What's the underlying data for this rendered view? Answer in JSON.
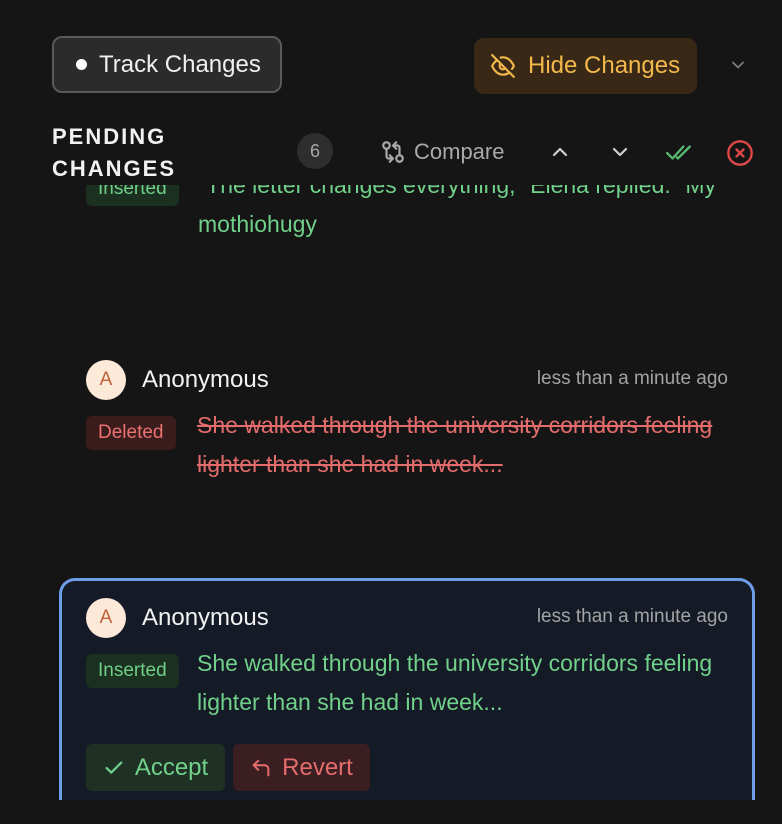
{
  "toolbar": {
    "track_label": "Track Changes",
    "hide_label": "Hide Changes"
  },
  "pending": {
    "title": "PENDING CHANGES",
    "count": "6",
    "compare_label": "Compare"
  },
  "changes": [
    {
      "type_label": "Inserted",
      "text": "\"The letter changes everything,\" Elena replied. \"My mothiohugy",
      "partial": true
    },
    {
      "avatar_letter": "A",
      "author": "Anonymous",
      "time": "less than a minute ago",
      "type_label": "Deleted",
      "text": "She walked through the university corridors feeling lighter than she had in week..."
    },
    {
      "avatar_letter": "A",
      "author": "Anonymous",
      "time": "less than a minute ago",
      "type_label": "Inserted",
      "text": "She walked through the university corridors feeling lighter than she had in week...",
      "accept_label": "Accept",
      "revert_label": "Revert"
    }
  ],
  "colors": {
    "background": "#151515",
    "accent_amber": "#f2b94a",
    "inserted_green": "#71d18a",
    "deleted_red": "#e46c6c",
    "active_border": "#6e9de8"
  },
  "icons": {
    "hide": "eye-off-icon",
    "dropdown": "chevron-down-icon",
    "compare": "git-compare-icon",
    "prev": "chevron-up-icon",
    "next": "chevron-down-icon",
    "accept_all": "double-check-icon",
    "reject_all": "x-circle-icon",
    "accept": "check-icon",
    "revert": "undo-icon"
  }
}
